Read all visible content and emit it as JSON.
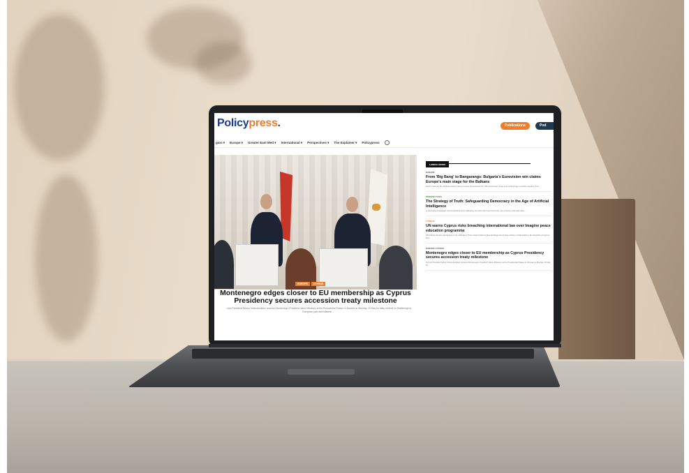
{
  "site": {
    "logo_part1": "Policy",
    "logo_part2": "press",
    "logo_part3": ".",
    "publications_button": "Publications",
    "podcast_button": "Pod",
    "accent_color": "#ee7e2d",
    "brand_color": "#1e3a8a"
  },
  "nav": {
    "items": [
      "gion ▾",
      "Europe ▾",
      "Greater East Med ▾",
      "International ▾",
      "Perspectives ▾",
      "The Explainer ▾",
      "Policypress"
    ],
    "search_icon": "search-icon"
  },
  "hero": {
    "tags": [
      "EUROPE",
      "CYPRUS"
    ],
    "title": "Montenegro edges closer to EU membership as Cyprus Presidency secures accession treaty milestone",
    "excerpt": "...cian President Nikos Christodoulides received Montenegro President Jakov Milatović at the Presidential Palace in Nicosia on Monday, 19 May for talks centred on Montenegro's European path and bilateral ..."
  },
  "sidebar": {
    "heading": "Latest News",
    "items": [
      {
        "category": "EUROPE",
        "title": "From 'Big Bang' to Bangarangs: Bulgaria's Eurovision win claims Europe's main stage for the Balkans",
        "excerpt": "Held in Vienna, the 2026 Eurovision Song Contest represented the 70th anniversary of an event that brings countries together from..."
      },
      {
        "category": "PERSPECTIVES",
        "title": "The Strategy of Truth: Safeguarding Democracy in the Age of Artificial Intelligence",
        "excerpt": "In the world of strategic communications and marketing, we must ask how trust is the only currency with real value..."
      },
      {
        "category": "CYPRUS",
        "title": "UN warns Cyprus risks breaching international law over Imagine peace education programme",
        "excerpt": "UN activist are few participants in an unfinished Three United Nations Special Rapporteurs have written confidentially to the Republic of Cyprus and..."
      },
      {
        "category": "EUROPE  CYPRUS",
        "title": "Montenegro edges closer to EU membership as Cyprus Presidency secures accession treaty milestone",
        "excerpt": "Cyprus President Nikos Christodoulides received Montenegro President Jakov Milatović at the Presidential Palace in Nicosia on Monday 19 May for..."
      }
    ]
  }
}
